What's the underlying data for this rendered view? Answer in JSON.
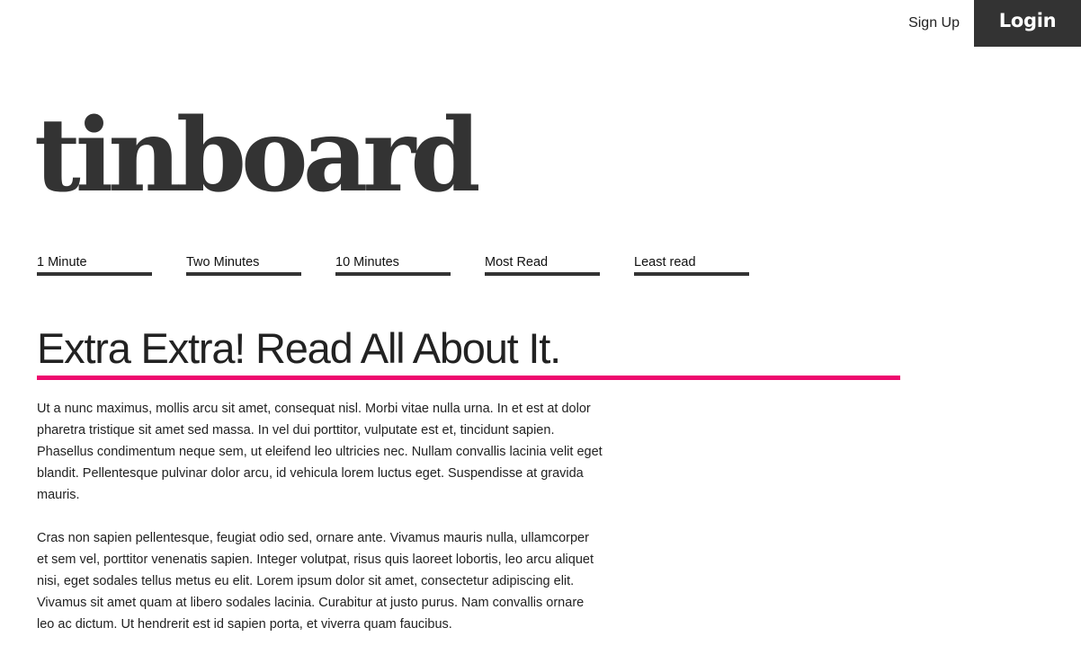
{
  "header": {
    "signup_label": "Sign Up",
    "login_label": "Login"
  },
  "brand": {
    "logo_text": "tinboard"
  },
  "nav": {
    "items": [
      {
        "label": "1 Minute"
      },
      {
        "label": "Two Minutes"
      },
      {
        "label": "10 Minutes"
      },
      {
        "label": "Most Read"
      },
      {
        "label": "Least read"
      }
    ]
  },
  "article": {
    "headline": "Extra Extra! Read All About It.",
    "paragraphs": [
      "Ut a nunc maximus, mollis arcu sit amet, consequat nisl. Morbi vitae nulla urna. In et est at dolor pharetra tristique sit amet sed massa. In vel dui porttitor, vulputate est et, tincidunt sapien. Phasellus condimentum neque sem, ut eleifend leo ultricies nec. Nullam convallis lacinia velit eget blandit. Pellentesque pulvinar dolor arcu, id vehicula lorem luctus eget. Suspendisse at gravida mauris.",
      "Cras non sapien pellentesque, feugiat odio sed, ornare ante. Vivamus mauris nulla, ullamcorper et sem vel, porttitor venenatis sapien. Integer volutpat, risus quis laoreet lobortis, leo arcu aliquet nisi, eget sodales tellus metus eu elit. Lorem ipsum dolor sit amet, consectetur adipiscing elit. Vivamus sit amet quam at libero sodales lacinia. Curabitur at justo purus. Nam convallis ornare leo ac dictum. Ut hendrerit est id sapien porta, et viverra quam faucibus."
    ]
  },
  "colors": {
    "accent": "#ee0a6e",
    "dark": "#333333",
    "text": "#222222",
    "background": "#ffffff"
  }
}
